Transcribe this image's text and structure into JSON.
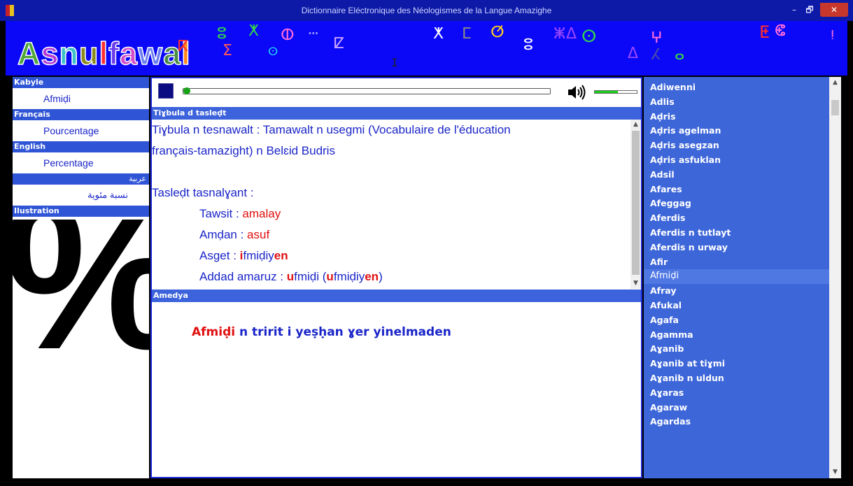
{
  "window": {
    "title": "Dictionnaire Eléctronique des Néologismes de la Langue Amazighe",
    "minimize": "–",
    "maximize": "🗗",
    "close": "✕"
  },
  "header": {
    "logo": [
      {
        "ch": "A",
        "color": "#4ea638"
      },
      {
        "ch": "s",
        "color": "#b23bd6"
      },
      {
        "ch": "n",
        "color": "#3cc0c8"
      },
      {
        "ch": "u",
        "color": "#8a8a1e"
      },
      {
        "ch": "l",
        "color": "#ff2d2d"
      },
      {
        "ch": "f",
        "color": "#6c3cf0"
      },
      {
        "ch": "a",
        "color": "#d14ec9"
      },
      {
        "ch": "w",
        "color": "#6b7ff0"
      },
      {
        "ch": "a",
        "color": "#4a8a46"
      },
      {
        "ch": "l",
        "color": "#ff8a1a"
      }
    ],
    "tifinagh_glyphs": [
      "ⴽ",
      "ⵓ",
      "ⵅ",
      "ⵉ",
      "ⵀ",
      "ⵙ",
      "ⵈ",
      "ⵇ",
      "ⵊ",
      "ⵅ",
      "ⵎ",
      "ⵚ",
      "ⵓ",
      "ⵥ",
      "ⵠ",
      "ⵙ",
      "ⵠ",
      "ⵖ",
      "ⵃ",
      "ⴰ",
      "ⵟ",
      "ⵞ",
      "ⵑ"
    ]
  },
  "left": {
    "kabyle_label": "Kabyle",
    "kabyle_value": "Afmiḍi",
    "french_label": "Français",
    "french_value": "Pourcentage",
    "english_label": "English",
    "english_value": "Percentage",
    "arabic_label": "عربية",
    "arabic_value": "نسبة مئوية",
    "illustration_label": "Ilustration",
    "illustration_symbol": "%"
  },
  "player": {
    "stop_icon": "stop-icon",
    "progress": 0,
    "volume": 0.55
  },
  "definition": {
    "header": "Tiɣbula d tasleḍt",
    "line1": "Tiɣbula n tesnawalt : Tamawalt n usegmi (Vocabulaire de l'éducation",
    "line2": "français-tamazight) n Belɛid Budris",
    "analysis_title": "Tasleḍt tasnalɣant :",
    "tawsit_label": "Tawsit : ",
    "tawsit_value": "amalay",
    "amdan_label": "Amḍan : ",
    "amdan_value": "asuf",
    "asget_label": "Asget  : ",
    "asget_p1": "i",
    "asget_p2": "fmiḍiy",
    "asget_p3": "en",
    "addad_label": "Addad amaruz : ",
    "addad_p1": "u",
    "addad_p2": "fmiḍi (",
    "addad_p3": "u",
    "addad_p4": "fmiḍiy",
    "addad_p5": "en",
    "addad_p6": ")"
  },
  "example": {
    "header": "Amedya",
    "word": "Afmiḍi",
    "rest": " n tririt i yeṣḥan ɣer yinelmaden"
  },
  "word_list": {
    "selected": "Afmiḍi",
    "items": [
      "Adiwenni",
      "Adlis",
      "Aḍris",
      "Aḍris agelman",
      "Aḍris asegzan",
      "Aḍris asfuklan",
      "Adsil",
      "Afares",
      "Afeggag",
      "Aferdis",
      "Aferdis n tutlayt",
      "Aferdis n urway",
      "Afir",
      "Afmiḍi",
      "Afray",
      "Afukal",
      "Agafa",
      "Agamma",
      "Aɣanib",
      "Aɣanib at tiɣmi",
      "Aɣanib n uldun",
      "Aɣaras",
      "Agaraw",
      "Agardas"
    ]
  }
}
